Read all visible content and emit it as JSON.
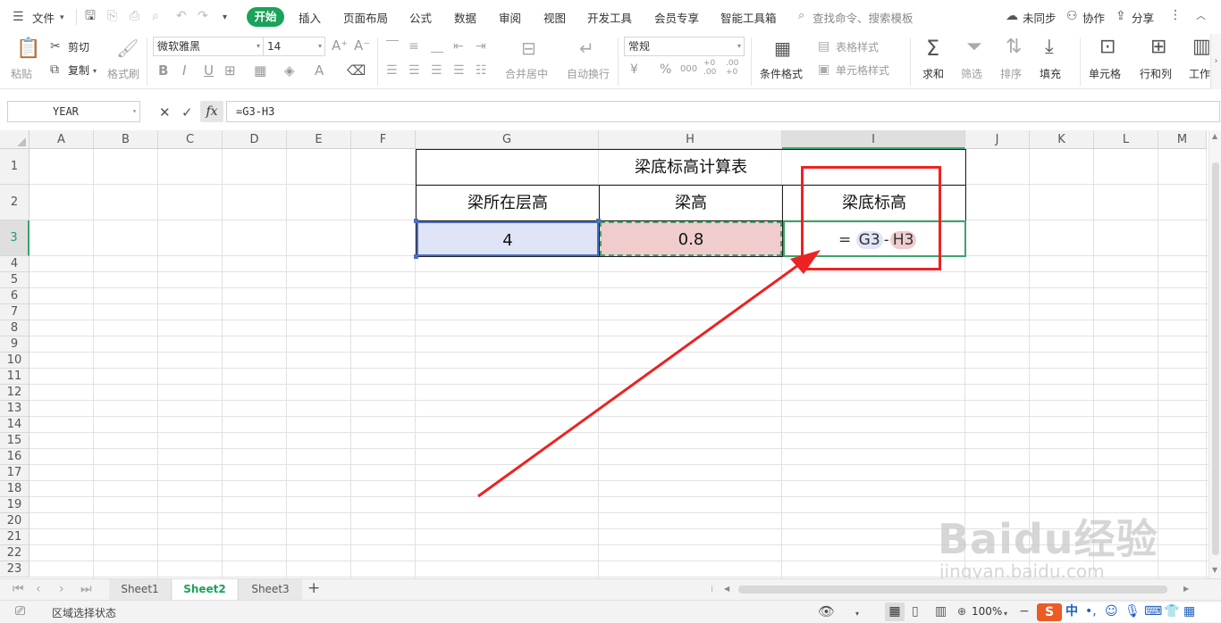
{
  "menubar": {
    "file_label": "文件",
    "tabs": [
      "开始",
      "插入",
      "页面布局",
      "公式",
      "数据",
      "审阅",
      "视图",
      "开发工具",
      "会员专享",
      "智能工具箱"
    ],
    "search_placeholder": "查找命令、搜索模板",
    "sync_label": "未同步",
    "collab_label": "协作",
    "share_label": "分享"
  },
  "ribbon": {
    "paste": "粘贴",
    "cut": "剪切",
    "copy": "复制",
    "format_painter": "格式刷",
    "font_name": "微软雅黑",
    "font_size": "14",
    "bold": "B",
    "italic": "I",
    "underline": "U",
    "merge_center": "合并居中",
    "wrap_text": "自动换行",
    "number_format": "常规",
    "currency": "¥",
    "percent": "%",
    "thousands": "000",
    "inc_decimal": "+0 .00",
    "dec_decimal": ".00 +0",
    "cond_format": "条件格式",
    "table_style": "表格样式",
    "cell_style": "单元格样式",
    "sum": "求和",
    "filter": "筛选",
    "sort": "排序",
    "fill": "填充",
    "cells": "单元格",
    "rows_cols": "行和列",
    "worksheet": "工作"
  },
  "formula_bar": {
    "name_box": "YEAR",
    "fx": "fx",
    "formula": "=G3-H3"
  },
  "grid": {
    "columns": [
      "A",
      "B",
      "C",
      "D",
      "E",
      "F",
      "G",
      "H",
      "I",
      "J",
      "K",
      "L",
      "M"
    ],
    "rows": [
      "1",
      "2",
      "3",
      "4",
      "5",
      "6",
      "7",
      "8",
      "9",
      "10",
      "11",
      "12",
      "13",
      "14",
      "15",
      "16",
      "17",
      "18",
      "19",
      "20",
      "21",
      "22",
      "23"
    ],
    "title": "梁底标高计算表",
    "headers": [
      "梁所在层高",
      "梁高",
      "梁底标高"
    ],
    "values": [
      "4",
      "0.8"
    ],
    "formula_parts": [
      "=",
      "G3",
      "-",
      "H3"
    ]
  },
  "sheets": [
    "Sheet1",
    "Sheet2",
    "Sheet3"
  ],
  "active_sheet": "Sheet2",
  "status": {
    "mode": "区域选择状态",
    "zoom": "100%"
  },
  "watermark": {
    "brand": "Baidu经验",
    "url": "jingyan.baidu.com"
  },
  "colors": {
    "accent": "#1aa35a",
    "ref_g3": "#dfe4f6",
    "ref_h3": "#f0cccc",
    "annotation": "#ee2222"
  }
}
